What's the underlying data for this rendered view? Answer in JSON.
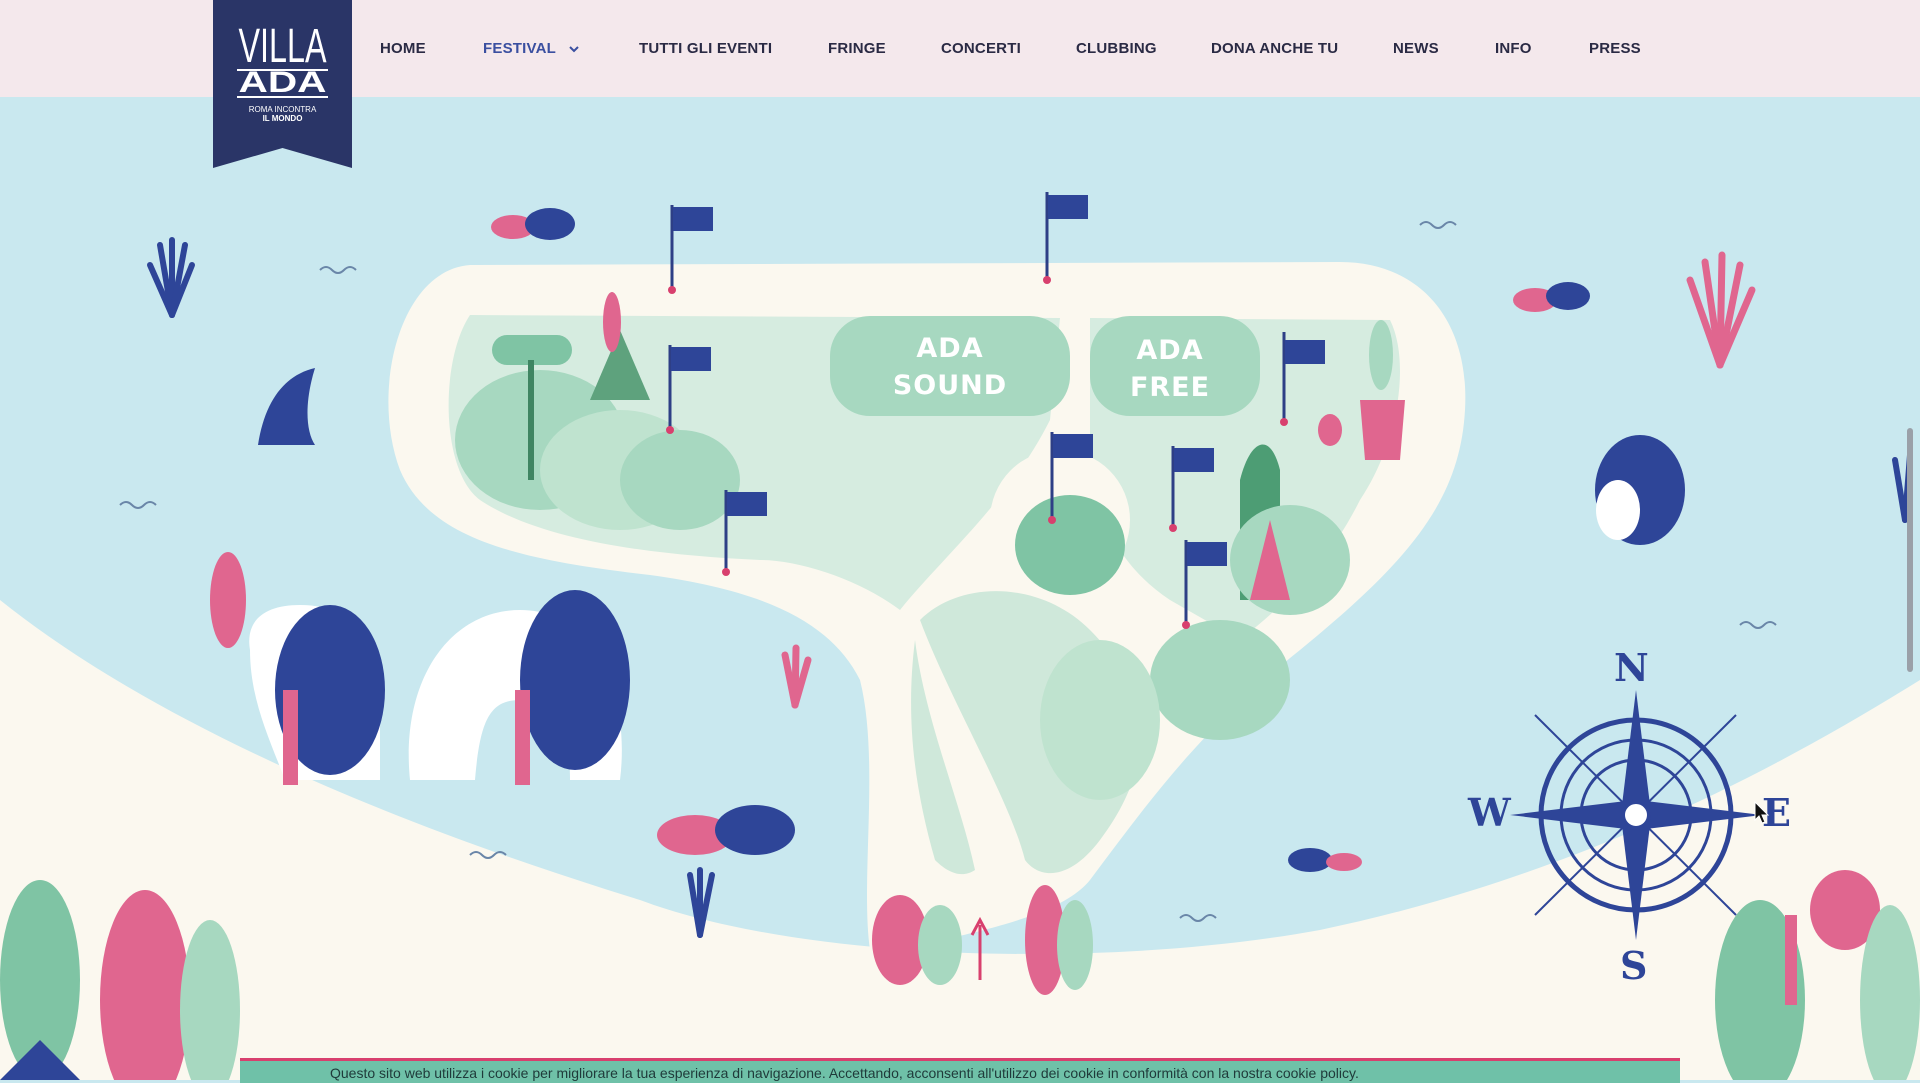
{
  "logo": {
    "line1": "VILLA",
    "line2": "ADA",
    "tagline1": "ROMA INCONTRA",
    "tagline2": "IL MONDO"
  },
  "menu": [
    {
      "label": "HOME",
      "active": false
    },
    {
      "label": "FESTIVAL",
      "active": true,
      "has_dropdown": true
    },
    {
      "label": "TUTTI GLI EVENTI",
      "active": false
    },
    {
      "label": "FRINGE",
      "active": false
    },
    {
      "label": "CONCERTI",
      "active": false
    },
    {
      "label": "CLUBBING",
      "active": false
    },
    {
      "label": "DONA ANCHE TU",
      "active": false
    },
    {
      "label": "NEWS",
      "active": false
    },
    {
      "label": "INFO",
      "active": false
    },
    {
      "label": "PRESS",
      "active": false
    }
  ],
  "map": {
    "stage1_line1": "ADA",
    "stage1_line2": "SOUND",
    "stage2_line1": "ADA",
    "stage2_line2": "FREE"
  },
  "compass": {
    "north": "N",
    "south": "S",
    "east": "E",
    "west": "W"
  },
  "footer_text": "Questo sito web utilizza i cookie per migliorare la tua esperienza di navigazione. Accettando, acconsenti all'utilizzo dei cookie in conformità con la nostra cookie policy.",
  "colors": {
    "navy": "#2e3f86",
    "pink": "#e0668f",
    "green": "#7fc4a4",
    "water": "#c9e8ef",
    "sand": "#fbf8ef",
    "nav_bg": "#f4e8ec"
  }
}
